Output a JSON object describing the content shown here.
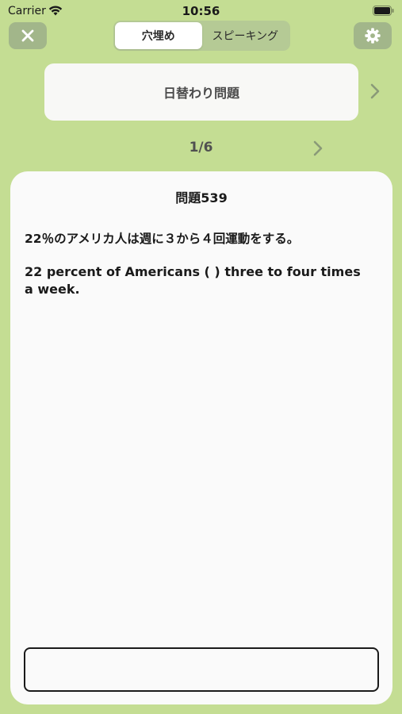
{
  "status_bar": {
    "carrier": "Carrier",
    "time": "10:56"
  },
  "toolbar": {
    "close_icon": "xmark-icon",
    "settings_icon": "gear-icon",
    "segments": [
      {
        "label": "穴埋め",
        "selected": true
      },
      {
        "label": "スピーキング",
        "selected": false
      }
    ]
  },
  "daily": {
    "label": "日替わり問題"
  },
  "pagination": {
    "counter": "1/6"
  },
  "question": {
    "title": "問題539",
    "japanese": "22％のアメリカ人は週に３から４回運動をする。",
    "english": "22 percent of Americans (  ) three to four times a week."
  },
  "answer": {
    "value": "",
    "placeholder": ""
  },
  "colors": {
    "background": "#c4dd93",
    "button": "#a2b68a",
    "card": "#fafafa",
    "chevron": "#8a9a78"
  }
}
